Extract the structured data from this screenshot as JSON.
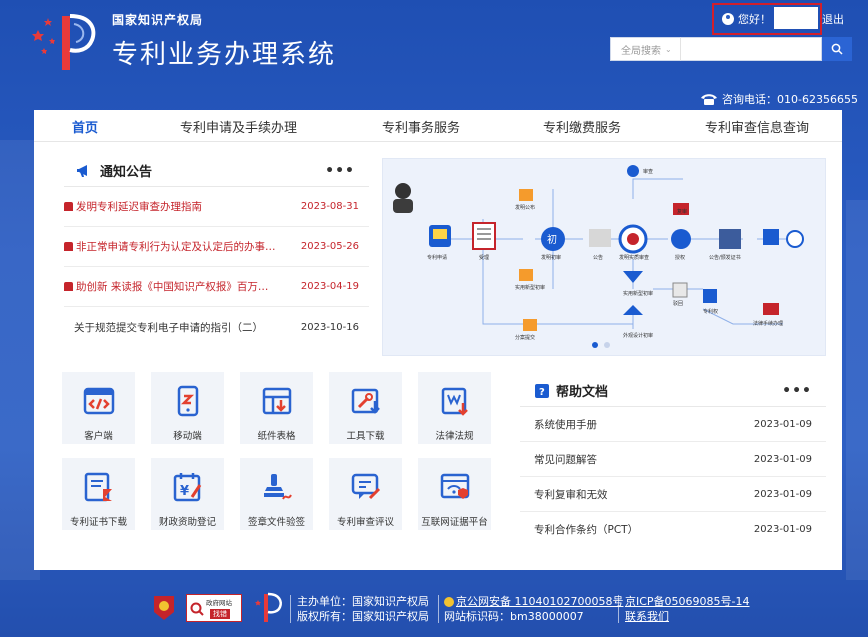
{
  "header": {
    "org_name": "国家知识产权局",
    "system_name": "专利业务办理系统",
    "greeting": "您好！",
    "logout": "退出",
    "search_scope": "全局搜索",
    "search_placeholder": "",
    "hotline": "咨询电话：010-62356655"
  },
  "nav": {
    "items": [
      {
        "label": "首页"
      },
      {
        "label": "专利申请及手续办理"
      },
      {
        "label": "专利事务服务"
      },
      {
        "label": "专利缴费服务"
      },
      {
        "label": "专利审查信息查询"
      }
    ]
  },
  "notice": {
    "title": "通知公告",
    "more": "•••",
    "items": [
      {
        "title": "发明专利延迟审查办理指南",
        "date": "2023-08-31",
        "important": true
      },
      {
        "title": "非正常申请专利行为认定及认定后的办事…",
        "date": "2023-05-26",
        "important": true
      },
      {
        "title": "助创新 来读报《中国知识产权报》百万…",
        "date": "2023-04-19",
        "important": true
      },
      {
        "title": "关于规范提交专利电子申请的指引（二）",
        "date": "2023-10-16",
        "important": false
      }
    ]
  },
  "banner": {
    "labels": [
      "专利申请",
      "受理",
      "发明公布",
      "初",
      "发明初审",
      "公告",
      "发明实质审查",
      "授权",
      "公告/颁发证书",
      "实用新型初审",
      "外观设计初审",
      "驳回",
      "复审",
      "专利权",
      "法律手续办理",
      "审查",
      "分案提交"
    ]
  },
  "tiles": [
    {
      "label": "客户端",
      "icon": "code-window-icon"
    },
    {
      "label": "移动端",
      "icon": "mobile-icon"
    },
    {
      "label": "纸件表格",
      "icon": "table-download-icon"
    },
    {
      "label": "工具下载",
      "icon": "tools-download-icon"
    },
    {
      "label": "法律法规",
      "icon": "law-book-icon"
    },
    {
      "label": "专利证书下载",
      "icon": "certificate-download-icon"
    },
    {
      "label": "财政资助登记",
      "icon": "funding-icon"
    },
    {
      "label": "签章文件验签",
      "icon": "stamp-icon"
    },
    {
      "label": "专利审查评议",
      "icon": "review-comment-icon"
    },
    {
      "label": "互联网证据平台",
      "icon": "evidence-platform-icon"
    }
  ],
  "help": {
    "title": "帮助文档",
    "more": "•••",
    "items": [
      {
        "title": "系统使用手册",
        "date": "2023-01-09"
      },
      {
        "title": "常见问题解答",
        "date": "2023-01-09"
      },
      {
        "title": "专利复审和无效",
        "date": "2023-01-09"
      },
      {
        "title": "专利合作条约（PCT）",
        "date": "2023-01-09"
      }
    ]
  },
  "footer": {
    "sponsor": "主办单位：国家知识产权局",
    "copyright": "版权所有：国家知识产权局",
    "security": "京公网安备 11040102700058号",
    "site_code": "网站标识码：bm38000007",
    "icp": "京ICP备05069085号-14",
    "contact": "联系我们",
    "gov_badge_top": "政府网站",
    "gov_badge_bottom": "找错"
  },
  "colors": {
    "accent": "#1a5bd0",
    "alert": "#c5242b",
    "bg": "#2a5cc2"
  }
}
